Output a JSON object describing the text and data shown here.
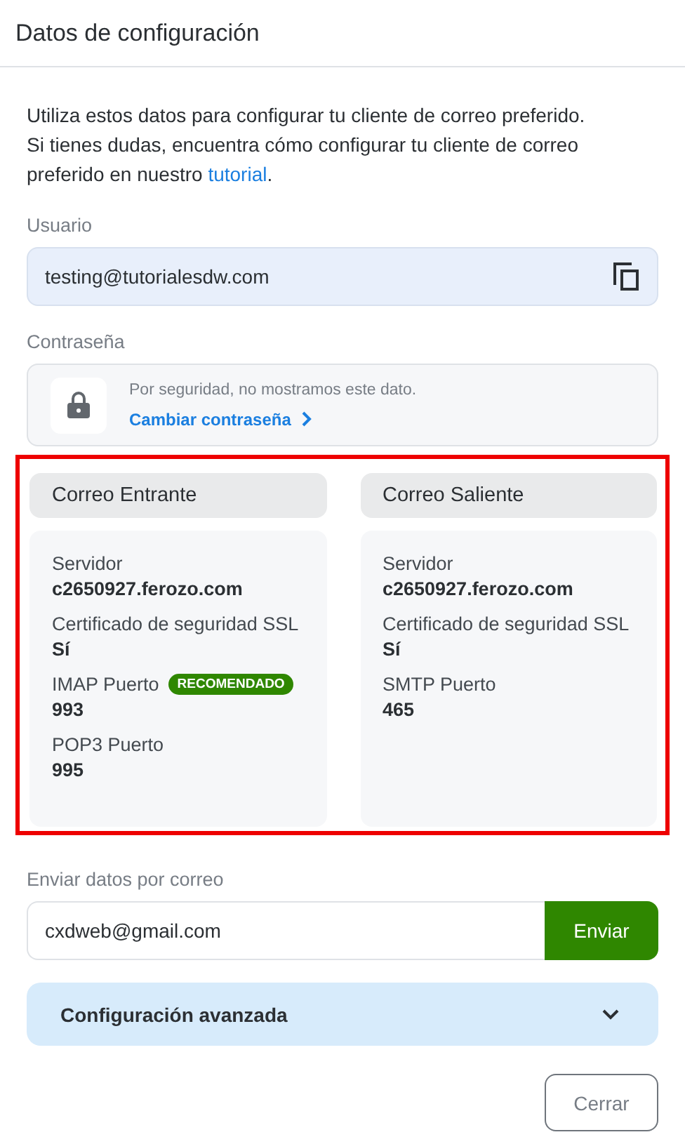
{
  "header": {
    "title": "Datos de configuración"
  },
  "intro": {
    "text": "Utiliza estos datos para configurar tu cliente de correo preferido.",
    "help_text": "Si tienes dudas, encuentra cómo configurar tu cliente de correo preferido en nuestro",
    "link": "tutorial",
    "trailing": "."
  },
  "user": {
    "label": "Usuario",
    "value": "testing@tutorialesdw.com"
  },
  "password": {
    "label": "Contraseña",
    "note": "Por seguridad, no mostramos este dato.",
    "link": "Cambiar contraseña"
  },
  "servers": {
    "highlighted": true,
    "columns": [
      {
        "title": "Correo Entrante",
        "fields": [
          {
            "label": "Servidor",
            "value": "c2650927.ferozo.com"
          },
          {
            "label": "Certificado de seguridad SSL",
            "value": "Sí"
          },
          {
            "label": "IMAP Puerto",
            "badge": "RECOMENDADO",
            "value": "993"
          },
          {
            "label": "POP3 Puerto",
            "value": "995"
          }
        ]
      },
      {
        "title": "Correo Saliente",
        "fields": [
          {
            "label": "Servidor",
            "value": "c2650927.ferozo.com"
          },
          {
            "label": "Certificado de seguridad SSL",
            "value": "Sí"
          },
          {
            "label": "SMTP Puerto",
            "value": "465"
          }
        ]
      }
    ]
  },
  "send": {
    "label": "Enviar datos por correo",
    "value": "cxdweb@gmail.com",
    "button": "Enviar"
  },
  "advanced": {
    "title": "Configuración avanzada",
    "expanded": false
  },
  "footer": {
    "button": "Cerrar"
  }
}
